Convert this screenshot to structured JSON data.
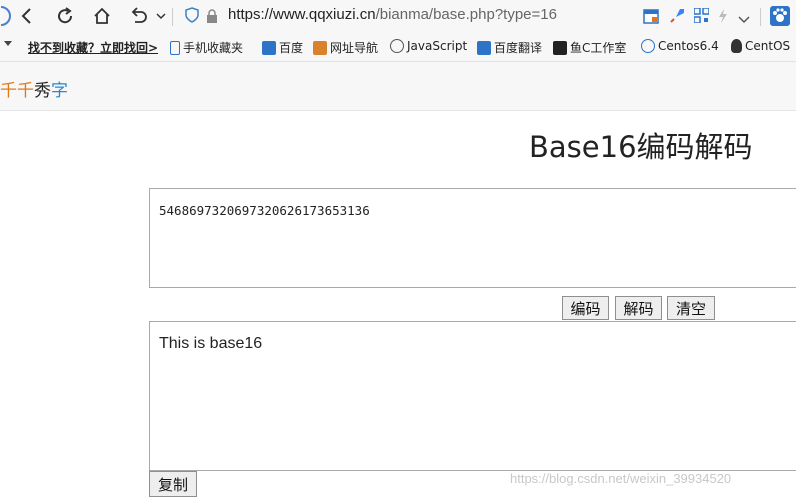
{
  "browser": {
    "url_host": "https://www.qqxiuzi.cn",
    "url_path": "/bianma/base.php?type=16",
    "bookmarks": [
      {
        "label": "找不到收藏？立即找回>"
      },
      {
        "label": "手机收藏夹"
      },
      {
        "label": "百度"
      },
      {
        "label": "网址导航"
      },
      {
        "label": "JavaScript"
      },
      {
        "label": "百度翻译"
      },
      {
        "label": "鱼C工作室"
      },
      {
        "label": "Centos6.4"
      },
      {
        "label": "CentOS"
      }
    ]
  },
  "site": {
    "logo_part1": "千千",
    "logo_part2": "秀",
    "logo_part3": "字"
  },
  "page": {
    "title": "Base16编码解码",
    "input_value": "5468697320697320626173653136",
    "output_value": "This is base16",
    "encode_label": "编码",
    "decode_label": "解码",
    "clear_label": "清空",
    "copy_label": "复制",
    "watermark": "https://blog.csdn.net/weixin_39934520"
  },
  "colors": {
    "logo_orange": "#e07a16",
    "logo_blue": "#2a88c9"
  }
}
